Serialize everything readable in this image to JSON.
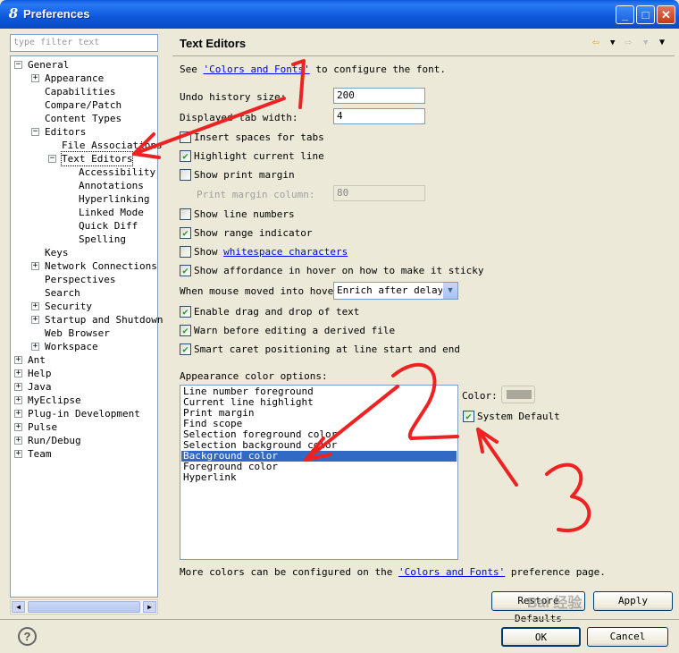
{
  "window": {
    "title": "Preferences",
    "app_icon": "eclipse-icon",
    "controls": [
      "_",
      "□",
      "✕"
    ]
  },
  "filter": {
    "placeholder": "type filter text"
  },
  "tree": [
    {
      "label": "General",
      "level": 0,
      "expander": "−"
    },
    {
      "label": "Appearance",
      "level": 1,
      "expander": "+"
    },
    {
      "label": "Capabilities",
      "level": 1,
      "expander": ""
    },
    {
      "label": "Compare/Patch",
      "level": 1,
      "expander": ""
    },
    {
      "label": "Content Types",
      "level": 1,
      "expander": ""
    },
    {
      "label": "Editors",
      "level": 1,
      "expander": "−"
    },
    {
      "label": "File Associations",
      "level": 2,
      "expander": ""
    },
    {
      "label": "Text Editors",
      "level": 2,
      "expander": "−"
    },
    {
      "label": "Accessibility",
      "level": 3,
      "expander": ""
    },
    {
      "label": "Annotations",
      "level": 3,
      "expander": ""
    },
    {
      "label": "Hyperlinking",
      "level": 3,
      "expander": ""
    },
    {
      "label": "Linked Mode",
      "level": 3,
      "expander": ""
    },
    {
      "label": "Quick Diff",
      "level": 3,
      "expander": ""
    },
    {
      "label": "Spelling",
      "level": 3,
      "expander": ""
    },
    {
      "label": "Keys",
      "level": 1,
      "expander": ""
    },
    {
      "label": "Network Connections",
      "level": 1,
      "expander": "+"
    },
    {
      "label": "Perspectives",
      "level": 1,
      "expander": ""
    },
    {
      "label": "Search",
      "level": 1,
      "expander": ""
    },
    {
      "label": "Security",
      "level": 1,
      "expander": "+"
    },
    {
      "label": "Startup and Shutdown",
      "level": 1,
      "expander": "+"
    },
    {
      "label": "Web Browser",
      "level": 1,
      "expander": ""
    },
    {
      "label": "Workspace",
      "level": 1,
      "expander": "+"
    },
    {
      "label": "Ant",
      "level": 0,
      "expander": "+"
    },
    {
      "label": "Help",
      "level": 0,
      "expander": "+"
    },
    {
      "label": "Java",
      "level": 0,
      "expander": "+"
    },
    {
      "label": "MyEclipse",
      "level": 0,
      "expander": "+"
    },
    {
      "label": "Plug-in Development",
      "level": 0,
      "expander": "+"
    },
    {
      "label": "Pulse",
      "level": 0,
      "expander": "+"
    },
    {
      "label": "Run/Debug",
      "level": 0,
      "expander": "+"
    },
    {
      "label": "Team",
      "level": 0,
      "expander": "+"
    }
  ],
  "selected_tree_item": "Text Editors",
  "page": {
    "title": "Text Editors",
    "intro_prefix": "See ",
    "intro_link": "'Colors and Fonts'",
    "intro_suffix": " to configure the font.",
    "undo_label": "Undo history size:",
    "undo_value": "200",
    "tab_label": "Displayed tab width:",
    "tab_value": "4",
    "insert_spaces": {
      "label": "Insert spaces for tabs",
      "checked": false
    },
    "highlight_line": {
      "label": "Highlight current line",
      "checked": true
    },
    "print_margin": {
      "label": "Show print margin",
      "checked": false
    },
    "print_margin_col_label": "Print margin column:",
    "print_margin_col_value": "80",
    "line_numbers": {
      "label": "Show line numbers",
      "checked": false
    },
    "range_indicator": {
      "label": "Show range indicator",
      "checked": true
    },
    "whitespace_prefix": "Show ",
    "whitespace_link": "whitespace characters",
    "whitespace_checked": false,
    "affordance": {
      "label": "Show affordance in hover on how to make it sticky",
      "checked": true
    },
    "hover_label": "When mouse moved into hover:",
    "hover_value": "Enrich after delay",
    "drag_drop": {
      "label": "Enable drag and drop of text",
      "checked": true
    },
    "warn_derived": {
      "label": "Warn before editing a derived file",
      "checked": true
    },
    "smart_caret": {
      "label": "Smart caret positioning at line start and end",
      "checked": true
    },
    "appearance_label": "Appearance color options:",
    "color_options": [
      "Line number foreground",
      "Current line highlight",
      "Print margin",
      "Find scope",
      "Selection foreground color",
      "Selection background color",
      "Background color",
      "Foreground color",
      "Hyperlink"
    ],
    "selected_color_option": "Background color",
    "color_label": "Color:",
    "color_swatch": "#a9a89a",
    "system_default": {
      "label": "System Default",
      "checked": true
    },
    "more_prefix": "More colors can be configured on the ",
    "more_link": "'Colors and Fonts'",
    "more_suffix": " preference page.",
    "restore_defaults": "Restore Defaults",
    "apply": "Apply"
  },
  "footer": {
    "ok": "OK",
    "cancel": "Cancel",
    "help": "?"
  },
  "annotations": {
    "marks": [
      "1",
      "2",
      "3"
    ],
    "arrow_color": "#ee2222"
  },
  "watermark": "Bai 经验"
}
